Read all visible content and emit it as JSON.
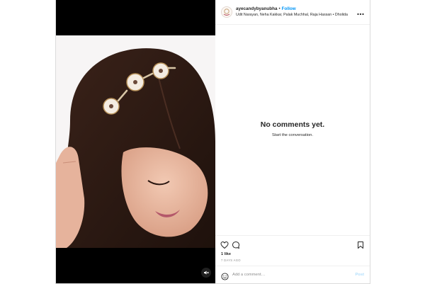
{
  "post": {
    "username": "ayecandybyanubha",
    "separator": "•",
    "follow_label": "Follow",
    "audio": "Udit Narayan, Neha Kakkar, Palak Muchhal, Raja Hassan • Dholida",
    "more_icon": "more-horizontal-icon",
    "mute_icon": "speaker-muted-icon"
  },
  "comments": {
    "empty_title": "No comments yet.",
    "empty_subtitle": "Start the conversation."
  },
  "actions": {
    "like_icon": "heart-icon",
    "comment_icon": "comment-bubble-icon",
    "save_icon": "bookmark-icon",
    "likes": "1 like",
    "time": "7 DAYS AGO"
  },
  "composer": {
    "placeholder": "Add a comment…",
    "post_label": "Post",
    "emoji_icon": "emoji-icon"
  },
  "colors": {
    "follow": "#0095f6",
    "post_disabled": "#b2dffc",
    "muted_text": "#8e8e8e"
  }
}
